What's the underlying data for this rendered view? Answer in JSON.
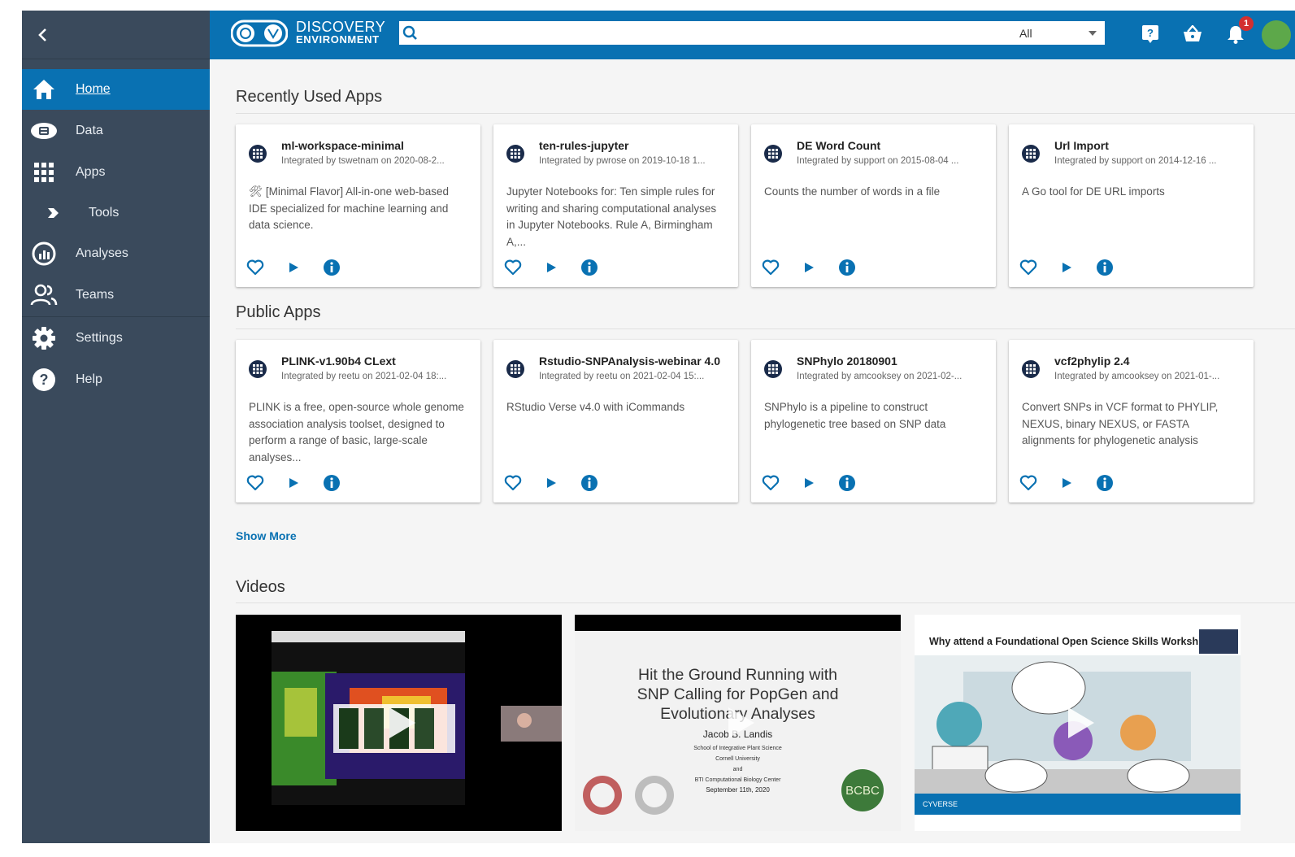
{
  "app": {
    "logo_line1": "DISCOVERY",
    "logo_line2": "ENVIRONMENT"
  },
  "sidebar": {
    "items": [
      {
        "label": "Home",
        "icon": "home-icon"
      },
      {
        "label": "Data",
        "icon": "data-icon"
      },
      {
        "label": "Apps",
        "icon": "apps-grid-icon"
      },
      {
        "label": "Tools",
        "icon": "chevron-right-icon"
      },
      {
        "label": "Analyses",
        "icon": "analyses-icon"
      },
      {
        "label": "Teams",
        "icon": "teams-icon"
      },
      {
        "label": "Settings",
        "icon": "gear-icon"
      },
      {
        "label": "Help",
        "icon": "help-icon"
      }
    ]
  },
  "header": {
    "search_placeholder": "",
    "search_filter": "All",
    "notification_count": "1"
  },
  "sections": {
    "recent_title": "Recently Used Apps",
    "public_title": "Public Apps",
    "show_more": "Show More",
    "videos_title": "Videos"
  },
  "recent_apps": [
    {
      "name": "ml-workspace-minimal",
      "integrated": "Integrated by tswetnam on 2020-08-2...",
      "description": "🛠 [Minimal Flavor] All-in-one web-based IDE specialized for machine learning and data science."
    },
    {
      "name": "ten-rules-jupyter",
      "integrated": "Integrated by pwrose on 2019-10-18 1...",
      "description": "Jupyter Notebooks for: Ten simple rules for writing and sharing computational analyses in Jupyter Notebooks. Rule A, Birmingham A,..."
    },
    {
      "name": "DE Word Count",
      "integrated": "Integrated by support on 2015-08-04 ...",
      "description": "Counts the number of words in a file"
    },
    {
      "name": "Url Import",
      "integrated": "Integrated by support on 2014-12-16 ...",
      "description": "A Go tool for DE URL imports"
    }
  ],
  "public_apps": [
    {
      "name": "PLINK-v1.90b4 CLext",
      "integrated": "Integrated by reetu on 2021-02-04 18:...",
      "description": "PLINK is a free, open-source whole genome association analysis toolset, designed to perform a range of basic, large-scale analyses..."
    },
    {
      "name": "Rstudio-SNPAnalysis-webinar 4.0",
      "integrated": "Integrated by reetu on 2021-02-04 15:...",
      "description": "RStudio Verse v4.0 with iCommands"
    },
    {
      "name": "SNPhylo 20180901",
      "integrated": "Integrated by amcooksey on 2021-02-...",
      "description": "SNPhylo is a pipeline to construct phylogenetic tree based on SNP data"
    },
    {
      "name": "vcf2phylip 2.4",
      "integrated": "Integrated by amcooksey on 2021-01-...",
      "description": "Convert SNPs in VCF format to PHYLIP, NEXUS, binary NEXUS, or FASTA alignments for phylogenetic analysis"
    }
  ],
  "videos": [
    {
      "caption": ""
    },
    {
      "title_lines": [
        "Hit the Ground Running with",
        "SNP Calling for PopGen and",
        "Evolutionary Analyses"
      ],
      "author": "Jacob B. Landis",
      "affil1": "School of Integrative Plant Science",
      "affil2": "Cornell University",
      "affil3": "and",
      "affil4": "BTI Computational Biology Center",
      "date": "September 11th, 2020",
      "logo_text": "BCBC"
    },
    {
      "title": "Why attend a Foundational Open Science Skills Worksh",
      "brand": "CYVERSE"
    }
  ],
  "colors": {
    "primary": "#0971b2",
    "sidebar": "#3a4a5c",
    "app_avatar": "#1a2b4a"
  }
}
